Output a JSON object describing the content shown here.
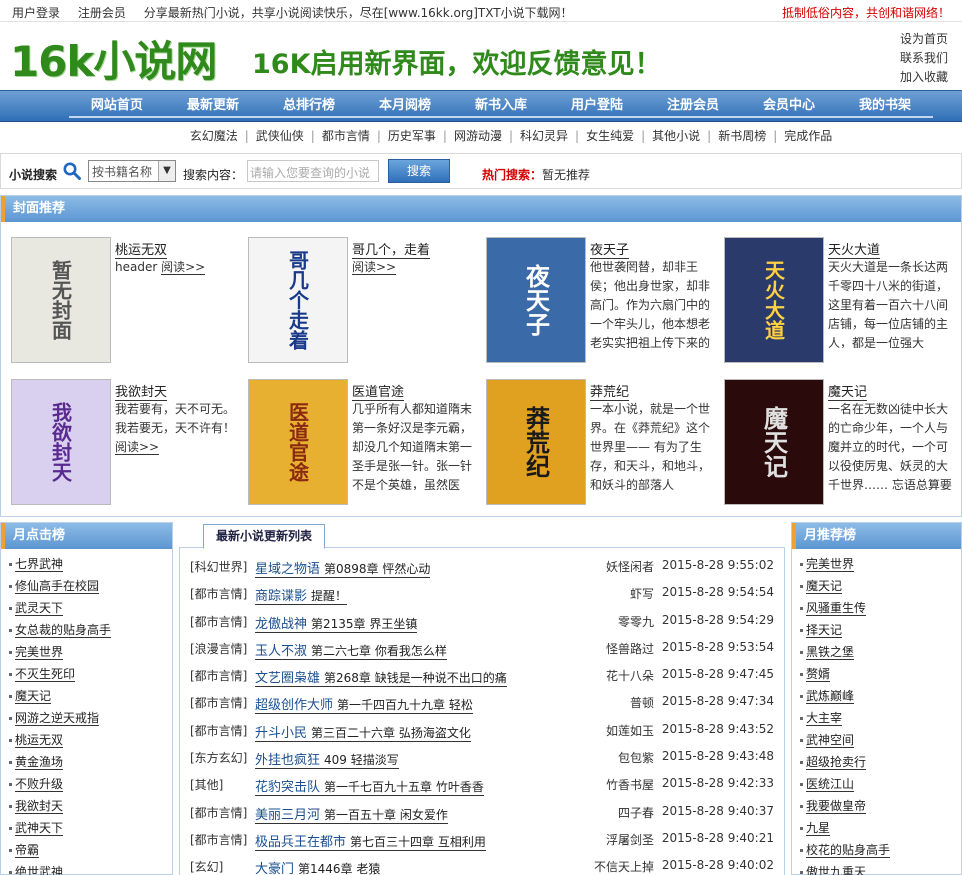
{
  "topbar": {
    "login": "用户登录",
    "register": "注册会员",
    "intro": "分享最新热门小说，共享小说阅读快乐，尽在[www.16kk.org]TXT小说下载网！",
    "notice": "抵制低俗内容，共创和谐网络！"
  },
  "header": {
    "logo": "16k小说网",
    "slogan": "16K启用新界面，欢迎反馈意见！",
    "links": [
      "设为首页",
      "联系我们",
      "加入收藏"
    ]
  },
  "mainnav": [
    "网站首页",
    "最新更新",
    "总排行榜",
    "本月阅榜",
    "新书入库",
    "用户登陆",
    "注册会员",
    "会员中心",
    "我的书架"
  ],
  "subnav": [
    "玄幻魔法",
    "武侠仙侠",
    "都市言情",
    "历史军事",
    "网游动漫",
    "科幻灵异",
    "女生纯爱",
    "其他小说",
    "新书周榜",
    "完成作品"
  ],
  "search": {
    "label": "小说搜索",
    "select_value": "按书籍名称",
    "content_label": "搜索内容：",
    "placeholder": "请输入您要查询的小说",
    "button": "搜索",
    "hot_label": "热门搜索：",
    "hot_value": "暂无推荐"
  },
  "cover": {
    "title": "封面推荐",
    "read_more": "阅读>>",
    "books": [
      {
        "title": "桃运无双",
        "desc": "header",
        "cover_text": "暂无封面",
        "read_link": true
      },
      {
        "title": "哥几个，走着",
        "desc": "",
        "cover_text": "哥几个走着",
        "read_link": true
      },
      {
        "title": "夜天子",
        "desc": "他世袭罔替，却非王侯；他出身世家，却非高门。作为六扇门中的一个牢头儿，他本想老老实实把祖上传下来的",
        "cover_text": "夜天子",
        "read_link": false
      },
      {
        "title": "天火大道",
        "desc": "天火大道是一条长达两千零四十八米的街道，这里有着一百六十八间店铺，每一位店铺的主人，都是一位强大",
        "cover_text": "天火大道",
        "read_link": false
      },
      {
        "title": "我欲封天",
        "desc": "我若要有，天不可无。我若要无，天不许有！",
        "cover_text": "我欲封天",
        "read_link": true
      },
      {
        "title": "医道官途",
        "desc": "几乎所有人都知道隋末第一条好汉是李元霸，却没几个知道隋末第一圣手是张一针。张一针不是个英雄，虽然医",
        "cover_text": "医道官途",
        "read_link": false
      },
      {
        "title": "莽荒纪",
        "desc": "一本小说，就是一个世界。在《莽荒纪》这个世界里—— 有为了生存，和天斗，和地斗，和妖斗的部落人",
        "cover_text": "莽荒纪",
        "read_link": false
      },
      {
        "title": "魔天记",
        "desc": "一名在无数凶徒中长大的亡命少年，一个人与魔并立的时代，一个可以役使厉鬼、妖灵的大千世界…… 忘语总算要",
        "cover_text": "魔天记",
        "read_link": false
      }
    ]
  },
  "left_col": {
    "title": "月点击榜",
    "items": [
      "七界武神",
      "修仙高手在校园",
      "武灵天下",
      "女总裁的贴身高手",
      "完美世界",
      "不灭生死印",
      "魔天记",
      "网游之逆天戒指",
      "桃运无双",
      "黄金渔场",
      "不败升级",
      "我欲封天",
      "武神天下",
      "帝霸",
      "绝世武神"
    ]
  },
  "right_col": {
    "title": "月推荐榜",
    "items": [
      "完美世界",
      "魔天记",
      "风骚重生传",
      "择天记",
      "黑铁之堡",
      "赘婿",
      "武炼巅峰",
      "大主宰",
      "武神空间",
      "超级抢卖行",
      "医统江山",
      "我要做皇帝",
      "九星",
      "校花的贴身高手",
      "傲世九重天"
    ]
  },
  "updates": {
    "tab": "最新小说更新列表",
    "rows": [
      {
        "cat": "[科幻世界]",
        "name": "星域之物语",
        "chapter": "第0898章 怦然心动",
        "author": "妖怪闲者",
        "time": "2015-8-28 9:55:02"
      },
      {
        "cat": "[都市言情]",
        "name": "商踪谍影",
        "chapter": "提醒！",
        "author": "虾写",
        "time": "2015-8-28 9:54:54"
      },
      {
        "cat": "[都市言情]",
        "name": "龙傲战神",
        "chapter": "第2135章 界王坐镇",
        "author": "零零九",
        "time": "2015-8-28 9:54:29"
      },
      {
        "cat": "[浪漫言情]",
        "name": "玉人不淑",
        "chapter": "第二六七章 你看我怎么样",
        "author": "怪兽路过",
        "time": "2015-8-28 9:53:54"
      },
      {
        "cat": "[都市言情]",
        "name": "文艺圈枭雄",
        "chapter": "第268章 缺钱是一种说不出口的痛",
        "author": "花十八朵",
        "time": "2015-8-28 9:47:45"
      },
      {
        "cat": "[都市言情]",
        "name": "超级创作大师",
        "chapter": "第一千四百九十九章 轻松",
        "author": "普顿",
        "time": "2015-8-28 9:47:34"
      },
      {
        "cat": "[都市言情]",
        "name": "升斗小民",
        "chapter": "第三百二十六章 弘扬海盗文化",
        "author": "如莲如玉",
        "time": "2015-8-28 9:43:52"
      },
      {
        "cat": "[东方玄幻]",
        "name": "外挂也疯狂",
        "chapter": "409 轻描淡写",
        "author": "包包紫",
        "time": "2015-8-28 9:43:48"
      },
      {
        "cat": "[其他]",
        "name": "花豹突击队",
        "chapter": "第一千七百九十五章 竹叶香香",
        "author": "竹香书屋",
        "time": "2015-8-28 9:42:33"
      },
      {
        "cat": "[都市言情]",
        "name": "美丽三月河",
        "chapter": "第一百五十章 闲女爱作",
        "author": "四子春",
        "time": "2015-8-28 9:40:37"
      },
      {
        "cat": "[都市言情]",
        "name": "极品兵王在都市",
        "chapter": "第七百三十四章 互相利用",
        "author": "浮屠剑圣",
        "time": "2015-8-28 9:40:21"
      },
      {
        "cat": "[玄幻]",
        "name": "大豪门",
        "chapter": "第1446章 老猿",
        "author": "不信天上掉",
        "time": "2015-8-28 9:40:02"
      }
    ]
  },
  "colors": {
    "logo_green": "#2f8a1b",
    "nav_blue": "#2f6fb8",
    "alert_red": "#d40000"
  }
}
